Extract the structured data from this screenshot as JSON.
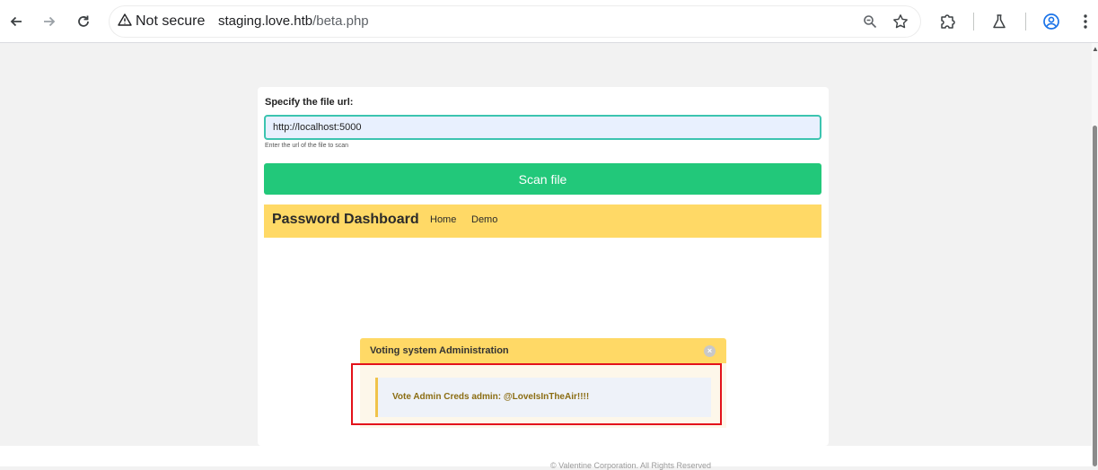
{
  "browser": {
    "security_label": "Not secure",
    "url_host": "staging.love.htb",
    "url_path": "/beta.php"
  },
  "form": {
    "label": "Specify the file url:",
    "input_value": "http://localhost:5000",
    "help_text": "Enter the url of the file to scan",
    "button_label": "Scan file"
  },
  "dashboard": {
    "title": "Password Dashboard",
    "links": [
      "Home",
      "Demo"
    ]
  },
  "notification": {
    "title": "Voting system Administration",
    "close_glyph": "×",
    "message": "Vote Admin Creds admin: @LoveIsInTheAir!!!!"
  },
  "footer": {
    "text": "© Valentine Corporation. All Rights Reserved"
  },
  "colors": {
    "accent_green": "#22c87a",
    "dashboard_yellow": "#ffd966",
    "highlight_red": "#e3121b",
    "input_border": "#3cc4b0"
  },
  "icons": [
    "back-arrow-icon",
    "forward-arrow-icon",
    "reload-icon",
    "warning-icon",
    "zoom-icon",
    "star-icon",
    "extensions-icon",
    "labs-flask-icon",
    "profile-icon",
    "more-vert-icon"
  ]
}
